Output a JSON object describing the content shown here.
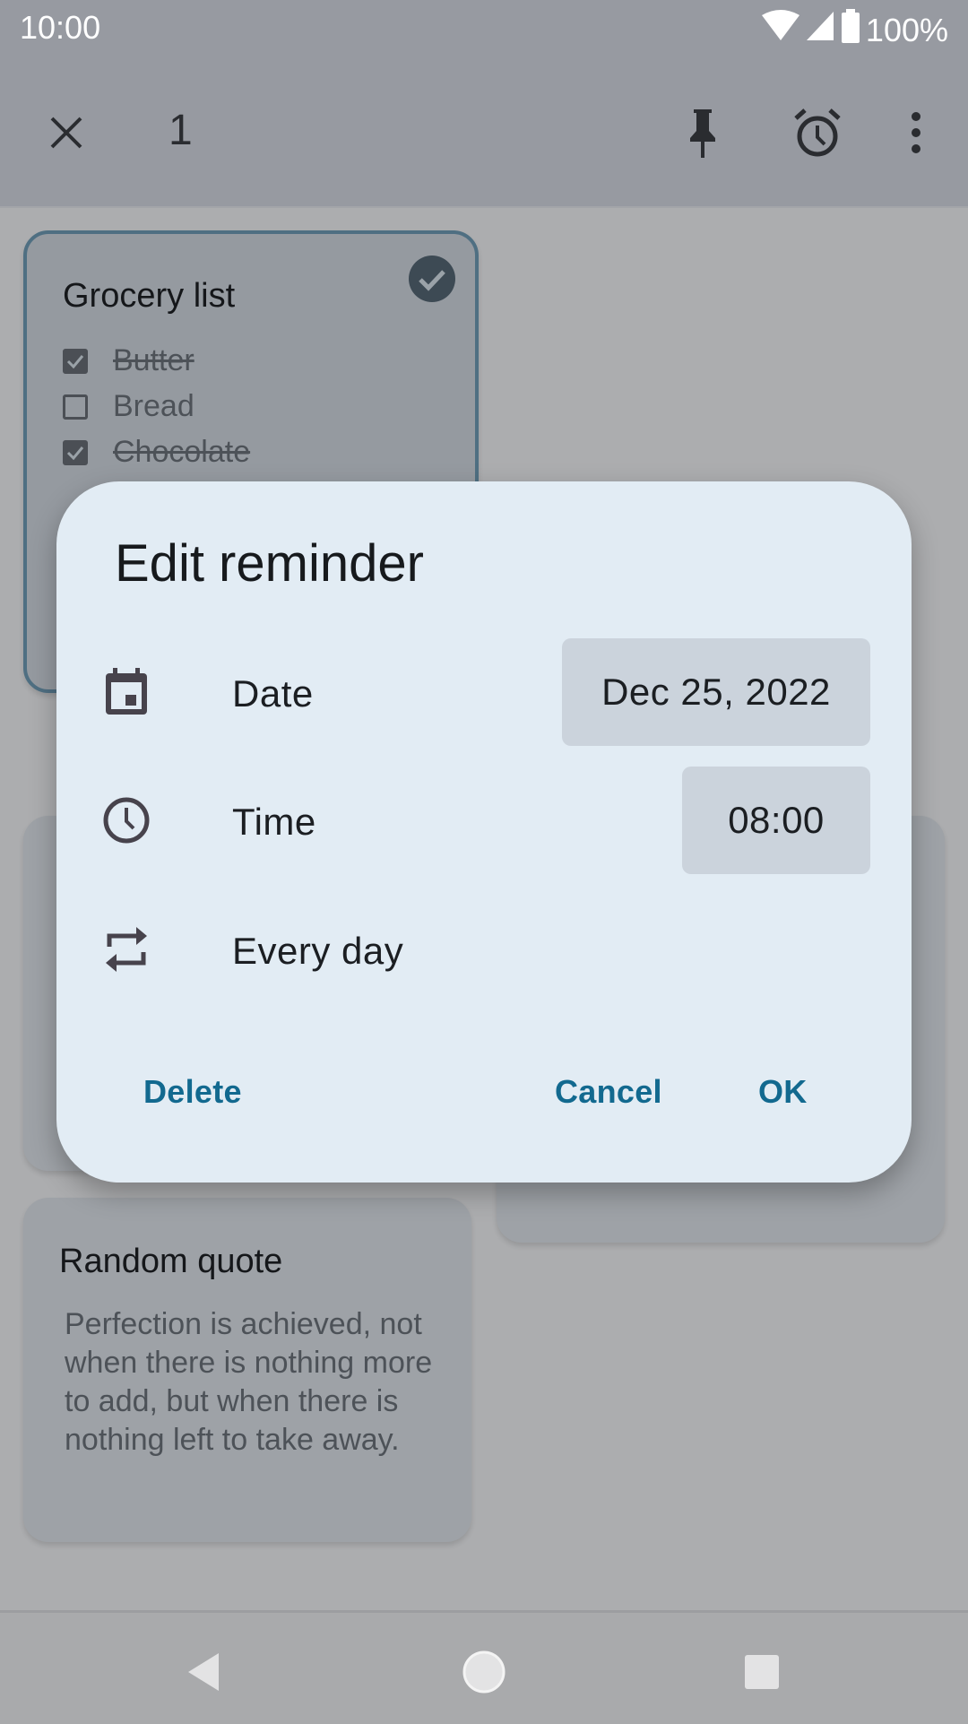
{
  "status_bar": {
    "time": "10:00",
    "battery": "100%",
    "icons": [
      "wifi-icon",
      "signal-icon",
      "battery-icon"
    ]
  },
  "app_bar": {
    "selected_count": "1",
    "actions": [
      "close-icon",
      "pin-icon",
      "alarm-icon",
      "more-vert-icon"
    ]
  },
  "notes": [
    {
      "title": "Grocery list",
      "selected": true,
      "items": [
        {
          "text": "Butter",
          "checked": true
        },
        {
          "text": "Bread",
          "checked": false
        },
        {
          "text": "Chocolate",
          "checked": true
        }
      ]
    },
    {
      "title": "Random quote",
      "body": "Perfection is achieved, not when there is nothing more to add, but when there is nothing left to take away."
    }
  ],
  "dialog": {
    "title": "Edit reminder",
    "rows": [
      {
        "icon": "calendar-icon",
        "label": "Date",
        "value": "Dec 25, 2022"
      },
      {
        "icon": "clock-icon",
        "label": "Time",
        "value": "08:00"
      },
      {
        "icon": "repeat-icon",
        "label": "Every day"
      }
    ],
    "buttons": {
      "delete": "Delete",
      "cancel": "Cancel",
      "ok": "OK"
    },
    "accent_color": "#12698f"
  },
  "nav_bar": [
    "back-icon",
    "home-icon",
    "recents-icon"
  ]
}
